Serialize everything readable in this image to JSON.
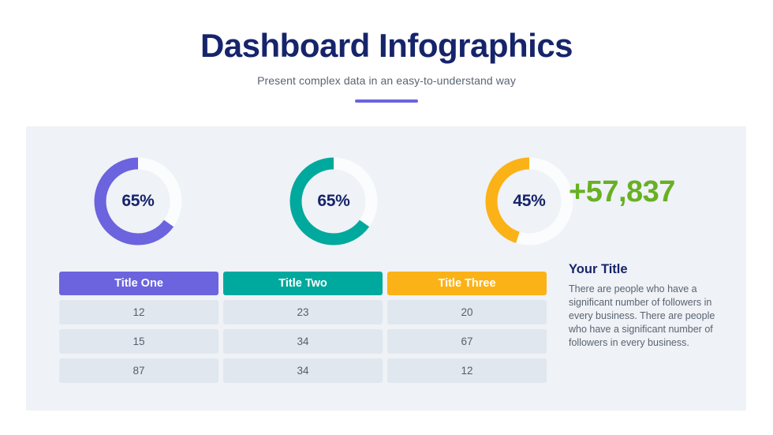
{
  "header": {
    "title": "Dashboard Infographics",
    "subtitle": "Present complex data in an easy-to-understand way",
    "accent_color": "#6C63DE"
  },
  "chart_data": [
    {
      "type": "pie",
      "variant": "donut",
      "name": "donut-one",
      "title": "",
      "categories": [
        "filled",
        "remaining"
      ],
      "values": [
        65,
        35
      ],
      "label": "65%",
      "color": "#6C63DE",
      "track_color": "#FBFCFD",
      "start_angle_deg": 0,
      "direction": "counterclockwise"
    },
    {
      "type": "pie",
      "variant": "donut",
      "name": "donut-two",
      "title": "",
      "categories": [
        "filled",
        "remaining"
      ],
      "values": [
        65,
        35
      ],
      "label": "65%",
      "color": "#00A99D",
      "track_color": "#FBFCFD",
      "start_angle_deg": 0,
      "direction": "counterclockwise"
    },
    {
      "type": "pie",
      "variant": "donut",
      "name": "donut-three",
      "title": "",
      "categories": [
        "filled",
        "remaining"
      ],
      "values": [
        45,
        55
      ],
      "label": "45%",
      "color": "#FBB217",
      "track_color": "#FBFCFD",
      "start_angle_deg": 0,
      "direction": "counterclockwise"
    }
  ],
  "stat": {
    "value": "+57,837",
    "color": "#68B023"
  },
  "table": {
    "headers": [
      "Title One",
      "Title Two",
      "Title Three"
    ],
    "header_colors": [
      "#6C63DE",
      "#00A99D",
      "#FBB217"
    ],
    "rows": [
      [
        "12",
        "23",
        "20"
      ],
      [
        "15",
        "34",
        "67"
      ],
      [
        "87",
        "34",
        "12"
      ]
    ]
  },
  "side": {
    "title": "Your Title",
    "body": "There are people who have a significant number of followers in every business. There are people who have a significant number of followers in every business."
  }
}
